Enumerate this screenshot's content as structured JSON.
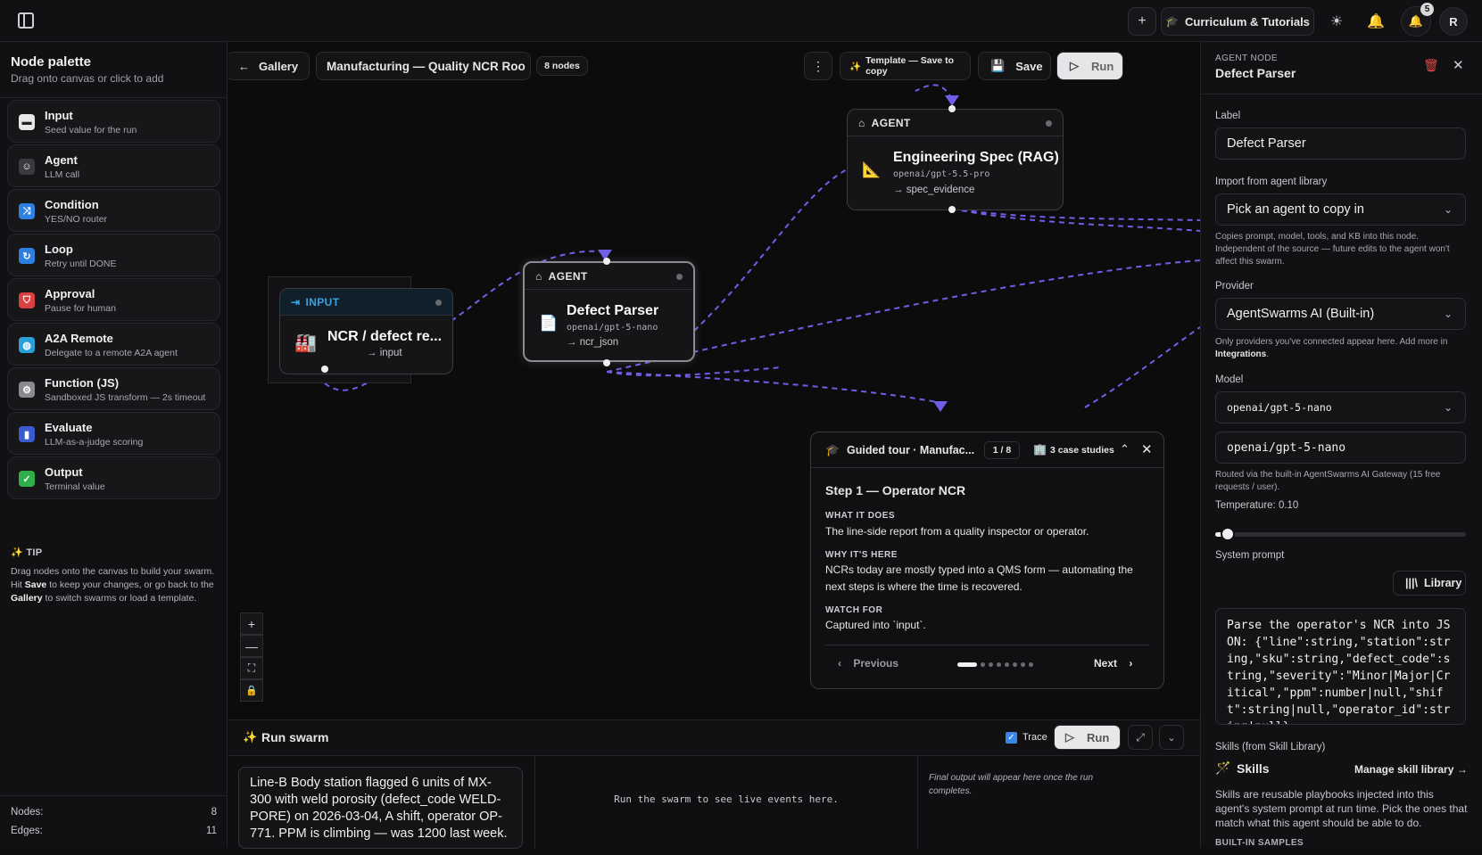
{
  "topbar": {
    "curriculum_label": "Curriculum & Tutorials",
    "notification_count": "5",
    "avatar_initial": "R"
  },
  "palette": {
    "title": "Node palette",
    "subtitle": "Drag onto canvas or click to add",
    "items": [
      {
        "label": "Input",
        "desc": "Seed value for the run",
        "icon": "input-icon",
        "color": "#e8e8ea"
      },
      {
        "label": "Agent",
        "desc": "LLM call",
        "icon": "robot-icon",
        "color": "#3a3a40"
      },
      {
        "label": "Condition",
        "desc": "YES/NO router",
        "icon": "shuffle-icon",
        "color": "#2f7fe0"
      },
      {
        "label": "Loop",
        "desc": "Retry until DONE",
        "icon": "repeat-icon",
        "color": "#2f7fe0"
      },
      {
        "label": "Approval",
        "desc": "Pause for human",
        "icon": "shield-icon",
        "color": "#d94040"
      },
      {
        "label": "A2A Remote",
        "desc": "Delegate to a remote A2A agent",
        "icon": "globe-icon",
        "color": "#2aa0d8"
      },
      {
        "label": "Function (JS)",
        "desc": "Sandboxed JS transform — 2s timeout",
        "icon": "gear-icon",
        "color": "#8a8a90"
      },
      {
        "label": "Evaluate",
        "desc": "LLM-as-a-judge scoring",
        "icon": "bar-chart-icon",
        "color": "#3a5ad0"
      },
      {
        "label": "Output",
        "desc": "Terminal value",
        "icon": "check-icon",
        "color": "#2fae4a"
      }
    ],
    "tip_heading": "TIP",
    "tip_text_1": "Drag nodes onto the canvas to build your swarm. Hit ",
    "tip_save": "Save",
    "tip_text_2": " to keep your changes, or go back to the ",
    "tip_gallery": "Gallery",
    "tip_text_3": " to switch swarms or load a template.",
    "stats": [
      {
        "label": "Nodes:",
        "value": "8"
      },
      {
        "label": "Edges:",
        "value": "11"
      }
    ]
  },
  "canvas": {
    "gallery_label": "Gallery",
    "swarm_name": "Manufacturing — Quality NCR Roo",
    "node_count": "8 nodes",
    "template_label": "Template — Save to copy",
    "save_label": "Save",
    "run_label": "Run",
    "nodes": {
      "input": {
        "type": "INPUT",
        "title": "NCR / defect re...",
        "out": "→ input"
      },
      "defect": {
        "type": "AGENT",
        "title": "Defect Parser",
        "model": "openai/gpt-5-nano",
        "out": "→ ncr_json"
      },
      "spec": {
        "type": "AGENT",
        "title": "Engineering Spec (RAG)",
        "model": "openai/gpt-5.5-pro",
        "out": "→ spec_evidence"
      }
    },
    "zoom": [
      "+",
      "—",
      "⛶",
      "🔒"
    ]
  },
  "tour": {
    "title": "Guided tour · Manufac...",
    "progress": "1 / 8",
    "case_studies": "3 case studies",
    "step_title": "Step 1 — Operator NCR",
    "what_k": "WHAT IT DOES",
    "what_v": "The line-side report from a quality inspector or operator.",
    "why_k": "WHY IT'S HERE",
    "why_v": "NCRs today are mostly typed into a QMS form — automating the next steps is where the time is recovered.",
    "watch_k": "WATCH FOR",
    "watch_v": "Captured into `input`.",
    "prev_label": "Previous",
    "next_label": "Next",
    "current_step": 1,
    "total_steps": 8
  },
  "run": {
    "title": "Run swarm",
    "trace_label": "Trace",
    "trace_checked": true,
    "run_label": "Run",
    "input_text": "Line-B Body station flagged 6 units of MX-300 with weld porosity (defect_code WELD-PORE) on 2026-03-04, A shift, operator OP-771. PPM is climbing — was 1200 last week.",
    "events_placeholder": "Run the swarm to see live events here.",
    "output_placeholder": "Final output will appear here once the run completes."
  },
  "inspector": {
    "kind": "AGENT NODE",
    "title": "Defect Parser",
    "label_caption": "Label",
    "label_value": "Defect Parser",
    "import_caption": "Import from agent library",
    "import_placeholder": "Pick an agent to copy in",
    "import_help": "Copies prompt, model, tools, and KB into this node. Independent of the source — future edits to the agent won't affect this swarm.",
    "provider_caption": "Provider",
    "provider_value": "AgentSwarms AI (Built-in)",
    "provider_help_1": "Only providers you've connected appear here. Add more in ",
    "provider_help_link": "Integrations",
    "provider_help_2": ".",
    "model_caption": "Model",
    "model_select": "openai/gpt-5-nano",
    "model_input": "openai/gpt-5-nano",
    "model_help": "Routed via the built-in AgentSwarms AI Gateway (15 free requests / user).",
    "temperature_label": "Temperature: 0.10",
    "temperature_value": 0.1,
    "system_prompt_caption": "System prompt",
    "library_label": "Library",
    "system_prompt": "Parse the operator's NCR into JSON: {\"line\":string,\"station\":string,\"sku\":string,\"defect_code\":string,\"severity\":\"Minor|Major|Critical\",\"ppm\":number|null,\"shift\":string|null,\"operator_id\":string|null}",
    "skills_caption": "Skills (from Skill Library)",
    "skills_title": "Skills",
    "manage_skills": "Manage skill library →",
    "skills_help": "Skills are reusable playbooks injected into this agent's system prompt at run time. Pick the ones that match what this agent should be able to do.",
    "builtin_samples": "BUILT-IN SAMPLES"
  },
  "colors": {
    "edge": "#6e5ee8",
    "background": "#0c0c0d",
    "panel": "#111113"
  }
}
